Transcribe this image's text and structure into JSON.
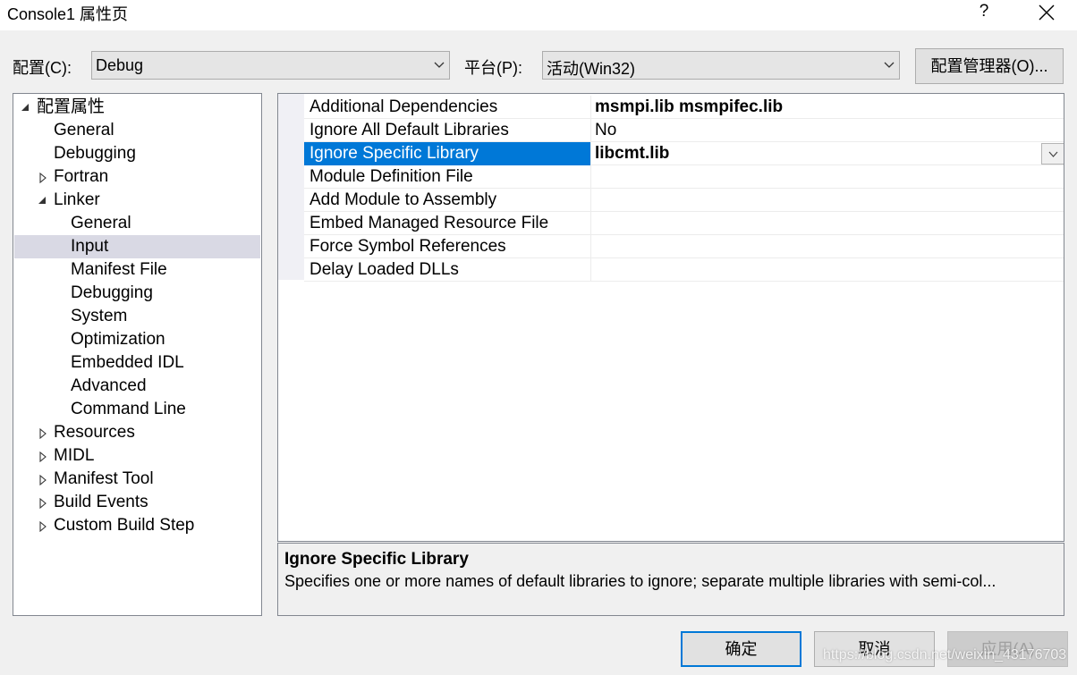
{
  "window": {
    "title": "Console1 属性页",
    "help_label": "?",
    "close_icon": "close-icon"
  },
  "config": {
    "label": "配置(C):",
    "value": "Debug"
  },
  "platform": {
    "label": "平台(P):",
    "value": "活动(Win32)"
  },
  "config_manager_label": "配置管理器(O)...",
  "tree": {
    "root": "配置属性",
    "items": {
      "general": "General",
      "debugging": "Debugging",
      "fortran": "Fortran",
      "linker": "Linker",
      "linker_general": "General",
      "linker_input": "Input",
      "linker_manifest": "Manifest File",
      "linker_debugging": "Debugging",
      "linker_system": "System",
      "linker_optimization": "Optimization",
      "linker_embedded_idl": "Embedded IDL",
      "linker_advanced": "Advanced",
      "linker_command_line": "Command Line",
      "resources": "Resources",
      "midl": "MIDL",
      "manifest_tool": "Manifest Tool",
      "build_events": "Build Events",
      "custom_build_step": "Custom Build Step"
    }
  },
  "properties": {
    "rows": [
      {
        "name": "Additional Dependencies",
        "value": "msmpi.lib msmpifec.lib"
      },
      {
        "name": "Ignore All Default Libraries",
        "value": "No"
      },
      {
        "name": "Ignore Specific Library",
        "value": "libcmt.lib"
      },
      {
        "name": "Module Definition File",
        "value": ""
      },
      {
        "name": "Add Module to Assembly",
        "value": ""
      },
      {
        "name": "Embed Managed Resource File",
        "value": ""
      },
      {
        "name": "Force Symbol References",
        "value": ""
      },
      {
        "name": "Delay Loaded DLLs",
        "value": ""
      }
    ]
  },
  "description": {
    "title": "Ignore Specific Library",
    "text": "Specifies one or more names of default libraries to ignore; separate multiple libraries with semi-col..."
  },
  "buttons": {
    "ok": "确定",
    "cancel": "取消",
    "apply": "应用(A)"
  },
  "watermark": "https://blog.csdn.net/weixin_43176703",
  "colors": {
    "selection": "#0078d7",
    "tree_selection": "#d9d9e4"
  }
}
